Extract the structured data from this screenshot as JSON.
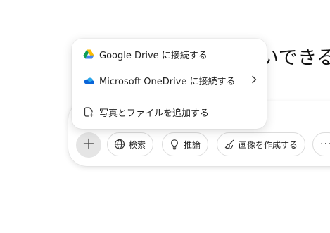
{
  "heading": {
    "text": "いできるこ"
  },
  "toolbar": {
    "search_label": "検索",
    "reason_label": "推論",
    "create_image_label": "画像を作成する",
    "more_label": "···"
  },
  "attach_menu": {
    "google_drive_label": "Google Drive に接続する",
    "onedrive_label": "Microsoft OneDrive に接続する",
    "add_files_label": "写真とファイルを追加する"
  },
  "icons": {
    "plus": "plus-icon",
    "search": "globe-icon",
    "reason": "lightbulb-icon",
    "create_image": "paintbrush-icon",
    "google_drive": "google-drive-icon",
    "onedrive": "onedrive-icon",
    "attach": "file-attach-icon",
    "chevron": "chevron-right-icon"
  }
}
